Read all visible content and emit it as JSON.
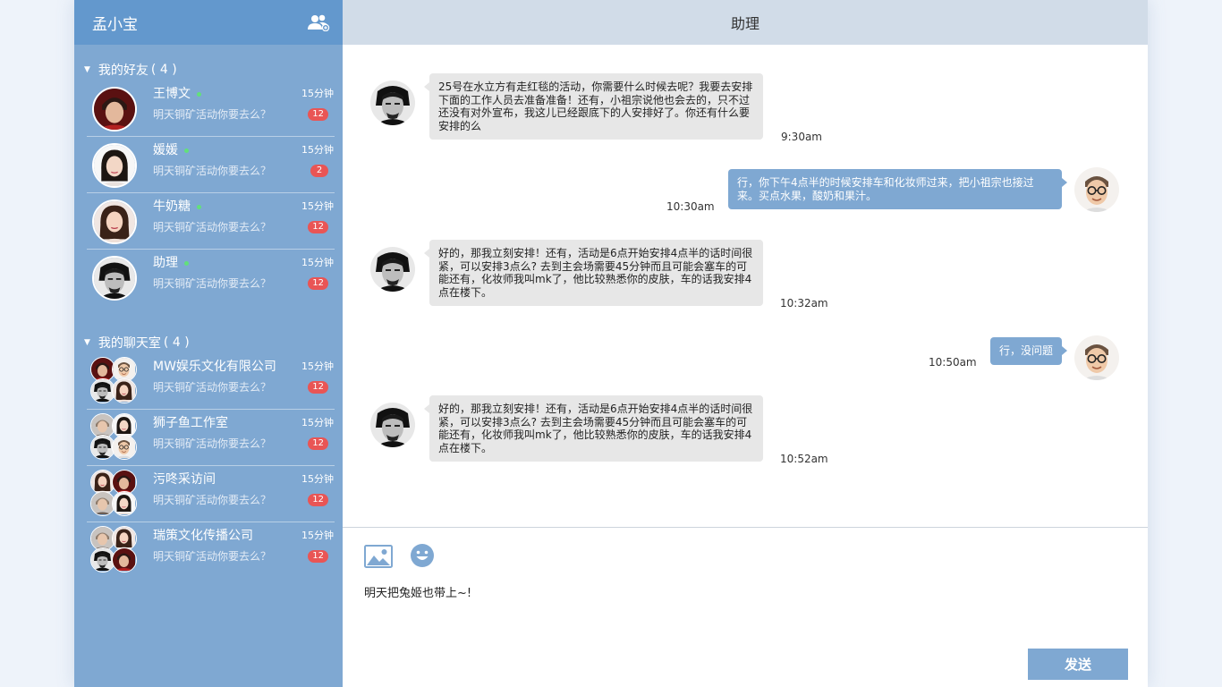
{
  "user": {
    "name": "孟小宝"
  },
  "sidebar": {
    "friends_section": {
      "title": "我的好友",
      "count": "( 4 )"
    },
    "friends": [
      {
        "name": "王博文",
        "preview": "明天铜矿活动你要去么？",
        "time": "15分钟",
        "badge": "12"
      },
      {
        "name": "媛媛",
        "preview": "明天铜矿活动你要去么？",
        "time": "15分钟",
        "badge": "2"
      },
      {
        "name": "牛奶糖",
        "preview": "明天铜矿活动你要去么？",
        "time": "15分钟",
        "badge": "12"
      },
      {
        "name": "助理",
        "preview": "明天铜矿活动你要去么？",
        "time": "15分钟",
        "badge": "12"
      }
    ],
    "rooms_section": {
      "title": "我的聊天室",
      "count": "( 4 )"
    },
    "rooms": [
      {
        "name": "MW娱乐文化有限公司",
        "preview": "明天铜矿活动你要去么？",
        "time": "15分钟",
        "badge": "12"
      },
      {
        "name": "狮子鱼工作室",
        "preview": "明天铜矿活动你要去么？",
        "time": "15分钟",
        "badge": "12"
      },
      {
        "name": "污咚采访间",
        "preview": "明天铜矿活动你要去么？",
        "time": "15分钟",
        "badge": "12"
      },
      {
        "name": "瑞策文化传播公司",
        "preview": "明天铜矿活动你要去么？",
        "time": "15分钟",
        "badge": "12"
      }
    ]
  },
  "chat": {
    "title": "助理",
    "messages": [
      {
        "side": "left",
        "text": "25号在水立方有走红毯的活动，你需要什么时候去呢？我要去安排下面的工作人员去准备准备！还有，小祖宗说他也会去的，只不过还没有对外宣布，我这儿已经跟底下的人安排好了。你还有什么要安排的么",
        "time": "9:30am"
      },
      {
        "side": "right",
        "text": "行，你下午4点半的时候安排车和化妆师过来，把小祖宗也接过来。买点水果，酸奶和果汁。",
        "time": "10:30am"
      },
      {
        "side": "left",
        "text": "好的，那我立刻安排！还有，活动是6点开始安排4点半的话时间很紧，可以安排3点么? 去到主会场需要45分钟而且可能会塞车的可能还有，化妆师我叫mk了，他比较熟悉你的皮肤，车的话我安排4点在楼下。",
        "time": "10:32am"
      },
      {
        "side": "right",
        "text": "行，没问题",
        "time": "10:50am"
      },
      {
        "side": "left",
        "text": "好的，那我立刻安排！还有，活动是6点开始安排4点半的话时间很紧，可以安排3点么? 去到主会场需要45分钟而且可能会塞车的可能还有，化妆师我叫mk了，他比较熟悉你的皮肤，车的话我安排4点在楼下。",
        "time": "10:52am"
      }
    ]
  },
  "composer": {
    "text": "明天把兔姬也带上~!",
    "send_label": "发送"
  },
  "icons": {
    "friends": "friends-icon",
    "image": "image-icon",
    "emoji": "emoji-icon",
    "arrow": "triangle-down-icon"
  },
  "colors": {
    "sidebar": "#7fa8d2",
    "sidebar_header": "#6398cd",
    "chat_header": "#d1dce8",
    "badge": "#e95555",
    "online": "#62e07a",
    "bubble_self": "#7fa8d2",
    "bubble_other": "#e7e7e7"
  }
}
